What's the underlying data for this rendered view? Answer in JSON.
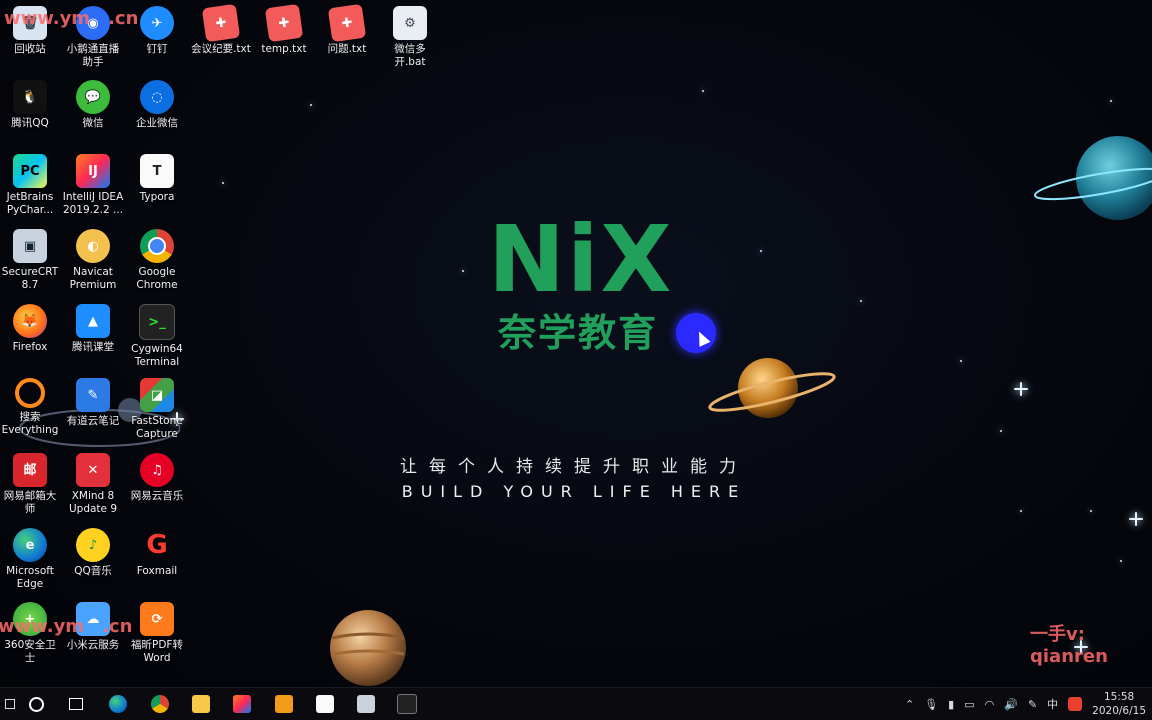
{
  "desktop": {
    "icons": [
      {
        "label": "回收站"
      },
      {
        "label": "小鹅通直播助手"
      },
      {
        "label": "钉钉"
      },
      {
        "label": "会议纪要.txt"
      },
      {
        "label": "temp.txt"
      },
      {
        "label": "问题.txt"
      },
      {
        "label": "微信多开.bat"
      },
      {
        "label": "腾讯QQ"
      },
      {
        "label": "微信"
      },
      {
        "label": "企业微信"
      },
      {
        "label": "JetBrains PyChar..."
      },
      {
        "label": "IntelliJ IDEA 2019.2.2 ..."
      },
      {
        "label": "Typora"
      },
      {
        "label": "SecureCRT 8.7"
      },
      {
        "label": "Navicat Premium"
      },
      {
        "label": "Google Chrome"
      },
      {
        "label": "Firefox"
      },
      {
        "label": "腾讯课堂"
      },
      {
        "label": "Cygwin64 Terminal"
      },
      {
        "label": "搜索 Everything"
      },
      {
        "label": "有道云笔记"
      },
      {
        "label": "FastStone Capture"
      },
      {
        "label": "网易邮箱大师"
      },
      {
        "label": "XMind 8 Update 9"
      },
      {
        "label": "网易云音乐"
      },
      {
        "label": "Microsoft Edge"
      },
      {
        "label": "QQ音乐"
      },
      {
        "label": "Foxmail"
      },
      {
        "label": "360安全卫士"
      },
      {
        "label": "小米云服务"
      },
      {
        "label": "福昕PDF转 Word"
      }
    ]
  },
  "brand": {
    "logo": "NiX",
    "name_cn": "奈学教育",
    "slogan_cn": "让每个人持续提升职业能力",
    "slogan_en": "BUILD YOUR LIFE HERE"
  },
  "watermarks": {
    "top_left": "www.ym",
    "top_left_suffix": ".cn",
    "bottom_left": "www.ym",
    "bottom_left_suffix": ".cn",
    "bottom_right": "一手v: qianren"
  },
  "taskbar": {
    "time": "15:58",
    "date": "2020/6/15",
    "ime": "中"
  }
}
